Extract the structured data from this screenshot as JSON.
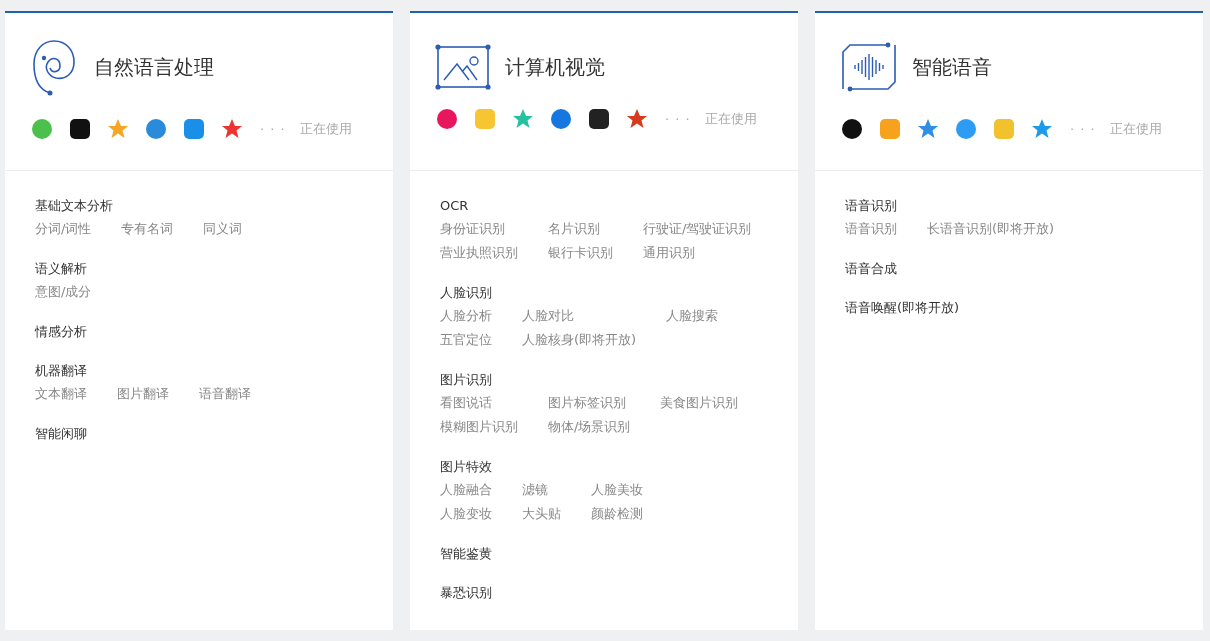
{
  "cards": [
    {
      "title": "自然语言处理",
      "more": "· · ·",
      "status": "正在使用",
      "groups": [
        {
          "title": "基础文本分析",
          "rows": [
            [
              "分词/词性",
              "专有名词",
              "同义词"
            ]
          ]
        },
        {
          "title": "语义解析",
          "rows": [
            [
              "意图/成分"
            ]
          ]
        },
        {
          "title": "情感分析"
        },
        {
          "title": "机器翻译",
          "rows": [
            [
              "文本翻译",
              "图片翻译",
              "语音翻译"
            ]
          ]
        },
        {
          "title": "智能闲聊"
        }
      ]
    },
    {
      "title": "计算机视觉",
      "more": "· · ·",
      "status": "正在使用",
      "groups": [
        {
          "title": "OCR",
          "rows": [
            [
              "身份证识别",
              "名片识别",
              "行驶证/驾驶证识别"
            ],
            [
              "营业执照识别",
              "银行卡识别",
              "通用识别"
            ]
          ]
        },
        {
          "title": "人脸识别",
          "rows": [
            [
              "人脸分析",
              "人脸对比",
              "人脸搜索"
            ],
            [
              "五官定位",
              "人脸核身(即将开放)"
            ]
          ]
        },
        {
          "title": "图片识别",
          "rows": [
            [
              "看图说话",
              "图片标签识别",
              "美食图片识别"
            ],
            [
              "模糊图片识别",
              "物体/场景识别"
            ]
          ]
        },
        {
          "title": "图片特效",
          "rows": [
            [
              "人脸融合",
              "滤镜",
              "人脸美妆"
            ],
            [
              "人脸变妆",
              "大头贴",
              "颜龄检测"
            ]
          ]
        },
        {
          "title": "智能鉴黄"
        },
        {
          "title": "暴恐识别"
        }
      ]
    },
    {
      "title": "智能语音",
      "more": "· · ·",
      "status": "正在使用",
      "groups": [
        {
          "title": "语音识别",
          "rows": [
            [
              "语音识别",
              "长语音识别(即将开放)"
            ]
          ]
        },
        {
          "title": "语音合成"
        },
        {
          "title": "语音唤醒(即将开放)"
        }
      ]
    }
  ]
}
